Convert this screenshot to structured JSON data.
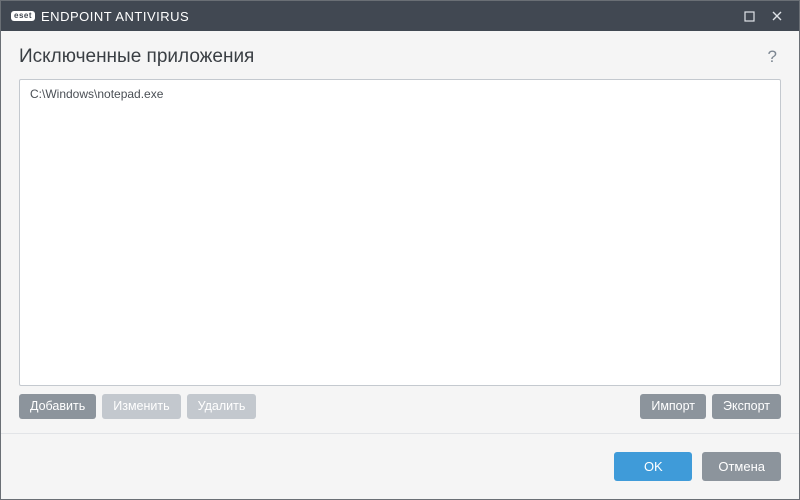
{
  "titlebar": {
    "brand_badge": "eset",
    "product_name": "ENDPOINT ANTIVIRUS"
  },
  "header": {
    "page_title": "Исключенные приложения",
    "help_symbol": "?"
  },
  "list": {
    "items": [
      {
        "path": "C:\\Windows\\notepad.exe"
      }
    ]
  },
  "actions": {
    "add": "Добавить",
    "edit": "Изменить",
    "delete": "Удалить",
    "import": "Импорт",
    "export": "Экспорт"
  },
  "footer": {
    "ok": "OK",
    "cancel": "Отмена"
  }
}
